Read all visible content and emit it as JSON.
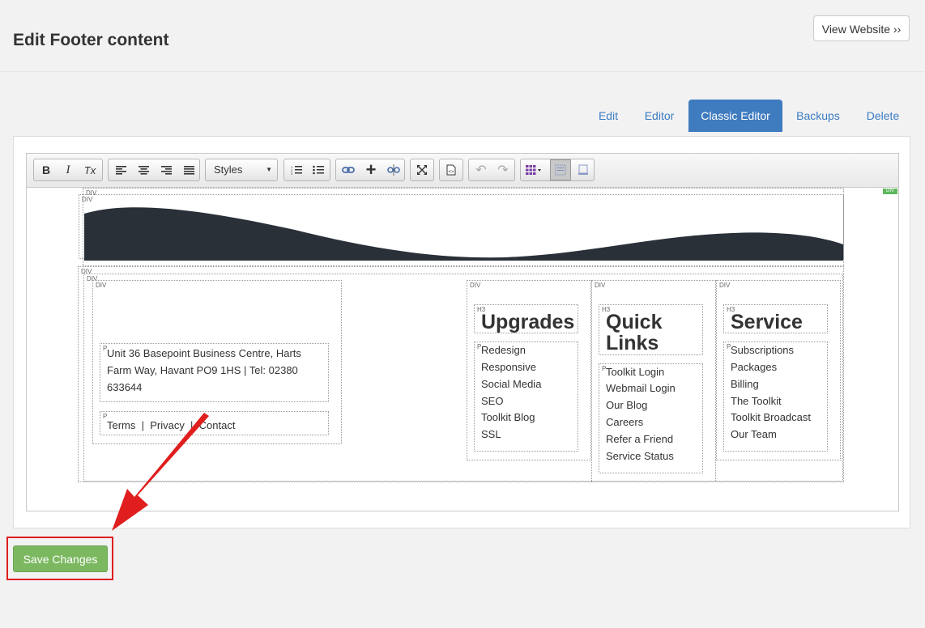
{
  "header": {
    "title": "Edit Footer content",
    "view_website_label": "View Website ››"
  },
  "tabs": [
    {
      "label": "Edit"
    },
    {
      "label": "Editor"
    },
    {
      "label": "Classic Editor"
    },
    {
      "label": "Backups"
    },
    {
      "label": "Delete"
    }
  ],
  "toolbar": {
    "styles_label": "Styles",
    "icons": [
      "bold-icon",
      "italic-icon",
      "remove-format-icon",
      "align-left-icon",
      "align-center-icon",
      "align-right-icon",
      "align-justify-icon",
      "numbered-list-icon",
      "bulleted-list-icon",
      "link-icon",
      "anchor-icon",
      "unlink-icon",
      "maximize-icon",
      "source-icon",
      "undo-icon",
      "redo-icon",
      "table-icon",
      "show-blocks-icon",
      "preview-icon"
    ],
    "bold": "B",
    "italic": "I",
    "remove_format": "Tx"
  },
  "content": {
    "tag_div": "DIV",
    "tag_p": "P",
    "tag_h3": "H3",
    "wave_color": "#2a3038",
    "address": [
      "Unit 36 Basepoint Business Centre, Harts",
      "Farm Way, Havant PO9 1HS | Tel: 02380",
      "633644"
    ],
    "legal_links": "Terms  |  Privacy  |  Contact",
    "columns": [
      {
        "title": "Upgrades",
        "items": [
          "Redesign",
          "Responsive",
          "Social Media",
          "SEO",
          "Toolkit Blog",
          "SSL"
        ]
      },
      {
        "title_lines": [
          "Quick",
          "Links"
        ],
        "items": [
          "Toolkit Login",
          "Webmail Login",
          "Our Blog",
          "Careers",
          "Refer a Friend",
          "Service Status"
        ]
      },
      {
        "title": "Service",
        "items": [
          "Subscriptions",
          "Packages",
          "Billing",
          "The Toolkit",
          "Toolkit Broadcast",
          "Our Team"
        ]
      }
    ]
  },
  "save_button_label": "Save Changes",
  "colors": {
    "tab_active": "#3f7bbf",
    "link": "#3b7cc4",
    "save": "#7cb860",
    "annotation": "#e01e1e"
  }
}
